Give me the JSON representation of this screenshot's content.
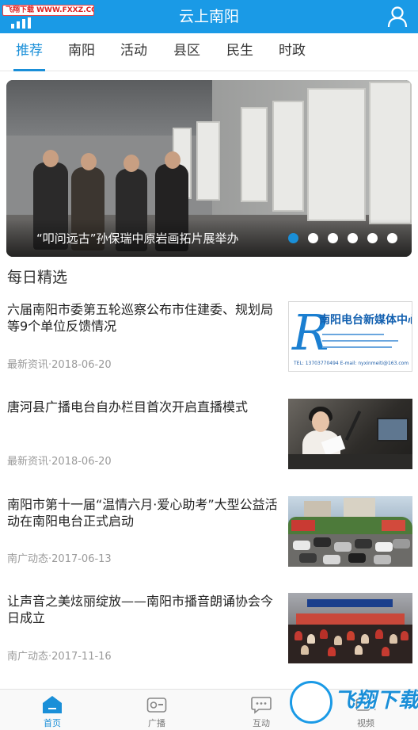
{
  "header": {
    "watermark": "飞翔下载 WWW.FXXZ.COM",
    "title": "云上南阳",
    "bg_color": "#1a9ae6"
  },
  "tabs": [
    {
      "label": "推荐",
      "active": true
    },
    {
      "label": "南阳",
      "active": false
    },
    {
      "label": "活动",
      "active": false
    },
    {
      "label": "县区",
      "active": false
    },
    {
      "label": "民生",
      "active": false
    },
    {
      "label": "时政",
      "active": false
    }
  ],
  "banner": {
    "caption": "“叩问远古”孙保瑞中原岩画拓片展举办",
    "slide_count": 6,
    "active_slide": 1
  },
  "section": {
    "title": "每日精选"
  },
  "articles": [
    {
      "title": "六届南阳市委第五轮巡察公布市住建委、规划局等9个单位反馈情况",
      "source": "最新资讯",
      "date": "2018-06-20",
      "thumb_text": "南阳电台新媒体中心",
      "thumb_contact": "TEL: 13703770494  E-mail: nyxinmeiti@163.com"
    },
    {
      "title": "唐河县广播电台自办栏目首次开启直播模式",
      "source": "最新资讯",
      "date": "2018-06-20"
    },
    {
      "title": "南阳市第十一届“温情六月·爱心助考”大型公益活动在南阳电台正式启动",
      "source": "南广动态",
      "date": "2017-06-13"
    },
    {
      "title": "让声音之美炫丽绽放——南阳市播音朗诵协会今日成立",
      "source": "南广动态",
      "date": "2017-11-16"
    }
  ],
  "bottom_nav": [
    {
      "label": "首页",
      "icon": "home-icon",
      "active": true
    },
    {
      "label": "广播",
      "icon": "radio-icon",
      "active": false
    },
    {
      "label": "互动",
      "icon": "chat-icon",
      "active": false
    },
    {
      "label": "视频",
      "icon": "video-icon",
      "active": false
    }
  ],
  "corner_watermark": "飞翔下载",
  "colors": {
    "accent": "#1a8fd8",
    "meta_text": "#9a9a9a"
  }
}
